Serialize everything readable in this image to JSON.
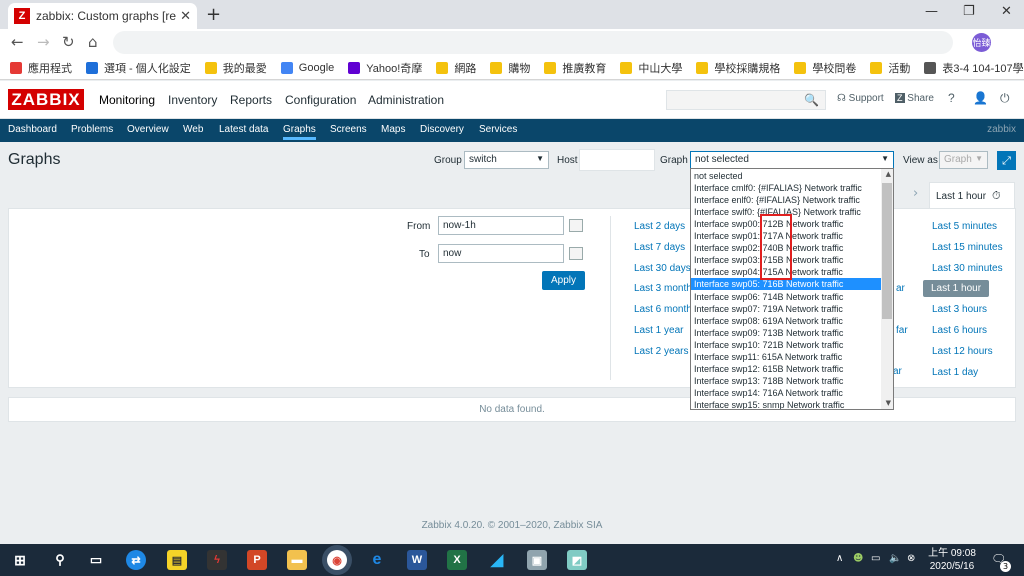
{
  "browser": {
    "tab_title": "zabbix: Custom graphs [refresh",
    "tab_favicon": "Z",
    "new_tab_icon": "+",
    "avatar_text": "怡臻"
  },
  "bookmarks": [
    {
      "label": "應用程式",
      "color": "#e53935"
    },
    {
      "label": "選項 - 個人化設定",
      "color": "#1e6fd9"
    },
    {
      "label": "我的最愛",
      "color": "#f4c20d"
    },
    {
      "label": "Google",
      "color": "#4285f4"
    },
    {
      "label": "Yahoo!奇摩",
      "color": "#6001d2"
    },
    {
      "label": "網路",
      "color": "#f4c20d"
    },
    {
      "label": "購物",
      "color": "#f4c20d"
    },
    {
      "label": "推廣教育",
      "color": "#f4c20d"
    },
    {
      "label": "中山大學",
      "color": "#f4c20d"
    },
    {
      "label": "學校採購規格",
      "color": "#f4c20d"
    },
    {
      "label": "學校問卷",
      "color": "#f4c20d"
    },
    {
      "label": "活動",
      "color": "#f4c20d"
    },
    {
      "label": "表3-4 104-107學...",
      "color": "#555555"
    }
  ],
  "zabbix": {
    "logo": "ZABBIX",
    "top_menu": [
      "Monitoring",
      "Inventory",
      "Reports",
      "Configuration",
      "Administration"
    ],
    "support": "Support",
    "share": "Share",
    "help": "?",
    "sub_menu": [
      "Dashboard",
      "Problems",
      "Overview",
      "Web",
      "Latest data",
      "Graphs",
      "Screens",
      "Maps",
      "Discovery",
      "Services"
    ],
    "sub_menu_active": "Graphs",
    "server_name": "zabbix"
  },
  "page": {
    "title": "Graphs",
    "group_label": "Group",
    "group_value": "switch",
    "host_label": "Host",
    "host_value": "",
    "graph_label": "Graph",
    "graph_value": "not selected",
    "view_as_label": "View as",
    "view_as_value": "Graph"
  },
  "filter": {
    "time_tab": "Last 1 hour",
    "from_label": "From",
    "from_value": "now-1h",
    "to_label": "To",
    "to_value": "now",
    "apply": "Apply",
    "quick_col1": [
      "Last 2 days",
      "Last 7 days",
      "Last 30 days",
      "Last 3 months",
      "Last 6 months",
      "Last 1 year",
      "Last 2 years"
    ],
    "quick_col2_partial": [
      "ar",
      "far",
      "ar"
    ],
    "quick_col3": [
      "Last 5 minutes",
      "Last 15 minutes",
      "Last 30 minutes",
      "Last 1 hour",
      "Last 3 hours",
      "Last 6 hours",
      "Last 12 hours",
      "Last 1 day"
    ],
    "selected_range": "Last 1 hour"
  },
  "dropdown": {
    "options": [
      "not selected",
      "Interface cmlf0: {#IFALIAS} Network traffic",
      "Interface enlf0: {#IFALIAS} Network traffic",
      "Interface swlf0: {#IFALIAS} Network traffic",
      "Interface swp00: 712B Network traffic",
      "Interface swp01: 717A Network traffic",
      "Interface swp02: 740B Network traffic",
      "Interface swp03: 715B Network traffic",
      "Interface swp04: 715A Network traffic",
      "Interface swp05: 716B Network traffic",
      "Interface swp06: 714B Network traffic",
      "Interface swp07: 719A Network traffic",
      "Interface swp08: 619A Network traffic",
      "Interface swp09: 713B Network traffic",
      "Interface swp10: 721B Network traffic",
      "Interface swp11: 615A Network traffic",
      "Interface swp12: 615B Network traffic",
      "Interface swp13: 718B Network traffic",
      "Interface swp14: 716A Network traffic",
      "Interface swp15: snmp Network traffic"
    ],
    "highlighted_index": 9
  },
  "no_data": "No data found.",
  "footer": "Zabbix 4.0.20. © 2001–2020, Zabbix SIA",
  "taskbar": {
    "time": "上午 09:08",
    "date": "2020/5/16",
    "notifications": "3"
  }
}
